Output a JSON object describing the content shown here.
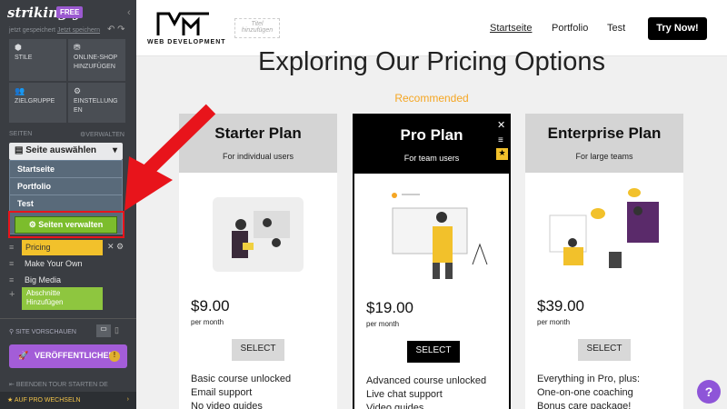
{
  "sidebar": {
    "logo": "strikingly",
    "badge": "FREE",
    "saved": "jetzt gespeichert",
    "saved_link": "Jetzt speichern",
    "tiles": [
      {
        "label": "STILE"
      },
      {
        "label": "ONLINE-SHOP HINZUFÜGEN"
      },
      {
        "label": "ZIELGRUPPE"
      },
      {
        "label": "EINSTELLUNG EN"
      }
    ],
    "section_label": "SEITEN",
    "manage_label": "VERWALTEN",
    "select_label": "Seite auswählen",
    "pages": [
      "Startseite",
      "Portfolio",
      "Test"
    ],
    "manage_button": "Seiten verwalten",
    "sections": [
      "Pricing",
      "Make Your Own",
      "Big Media"
    ],
    "add_section": "Abschnitte Hinzufügen",
    "preview": "SITE VORSCHAUEN",
    "publish": "VERÖFFENTLICHEN",
    "tour": "BEENDEN   TOUR STARTEN   DE",
    "upgrade": "AUF PRO WECHSELN"
  },
  "site": {
    "logo_text": "WEB DEVELOPMENT",
    "title_placeholder": "Titel hinzufügen",
    "nav": [
      "Startseite",
      "Portfolio",
      "Test"
    ],
    "cta": "Try Now!",
    "heading": "Exploring Our Pricing Options",
    "recommended": "Recommended",
    "plans": [
      {
        "name": "Starter Plan",
        "sub": "For individual users",
        "price": "$9.00",
        "period": "per month",
        "button": "SELECT",
        "features": [
          "Basic course unlocked",
          "Email support",
          "No video guides"
        ]
      },
      {
        "name": "Pro Plan",
        "sub": "For team users",
        "price": "$19.00",
        "period": "per month",
        "button": "SELECT",
        "features": [
          "Advanced course unlocked",
          "Live chat support",
          "Video guides"
        ]
      },
      {
        "name": "Enterprise Plan",
        "sub": "For large teams",
        "price": "$39.00",
        "period": "per month",
        "button": "SELECT",
        "features": [
          "Everything in Pro, plus:",
          "One-on-one coaching",
          "Bonus care package!"
        ]
      }
    ]
  },
  "colors": {
    "accent": "#a35dd8",
    "recommended": "#f5a623",
    "arrow": "#e8141b"
  }
}
